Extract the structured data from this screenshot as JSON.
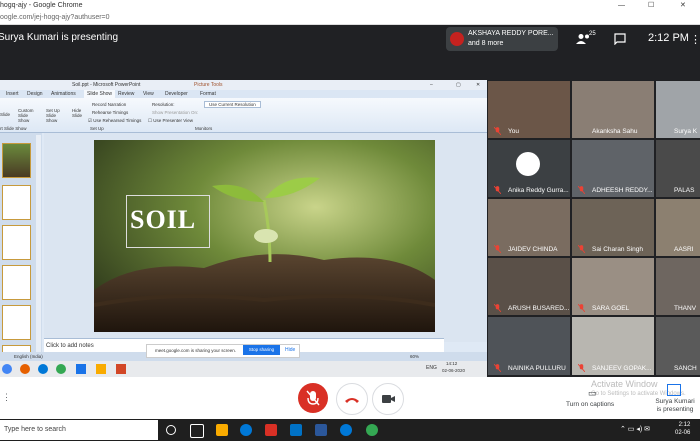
{
  "browser": {
    "tab_title": "hogq-ajy - Google Chrome",
    "url": "oogle.com/jej-hogq-ajy?authuser=0"
  },
  "meet": {
    "presenting_banner": "Surya Kumari is presenting",
    "notification_name": "AKSHAYA REDDY PORE...",
    "notification_more": "and 8 more",
    "people_count": "25",
    "time": "2:12 PM",
    "turn_on_captions": "Turn on captions",
    "presenter_line1": "Surya Kumari",
    "presenter_line2": "is presenting",
    "watermark_title": "Activate Window",
    "watermark_sub": "Go to Settings to activate Windows."
  },
  "powerpoint": {
    "window_title": "Soil.ppt - Microsoft PowerPoint",
    "picture_tools": "Picture Tools",
    "tabs": [
      "Insert",
      "Design",
      "Animations",
      "Slide Show",
      "Review",
      "View",
      "Developer",
      "Format"
    ],
    "ribbon": {
      "record_narration": "Record Narration",
      "rehearse_timings": "Rehearse Timings",
      "use_rehearsed": "Use Rehearsed Timings",
      "resolution": "Resolution:",
      "use_current_resolution": "Use Current Resolution",
      "show_presentation_on": "Show Presentation On:",
      "use_presenter_view": "Use Presenter View",
      "custom_slide_show": "Custom Slide Show",
      "set_up_slide_show": "Set Up Slide Show",
      "hide_slide": "Hide Slide",
      "slide_label": "Slide",
      "group_start": "rt Slide Show",
      "group_setup": "Set Up",
      "group_monitors": "Monitors"
    },
    "slide_word": "SOIL",
    "notes_placeholder": "Click to add notes",
    "status_language": "English (India)",
    "zoom": "60%",
    "share_notice": "meet.google.com is sharing your screen.",
    "stop_sharing": "Stop sharing",
    "hide": "Hide",
    "inner_clock_time": "14:12",
    "inner_clock_date": "02-06-2020",
    "inner_lang": "ENG"
  },
  "participants": [
    {
      "name": "You"
    },
    {
      "name": "Akanksha Sahu"
    },
    {
      "name": "Surya K"
    },
    {
      "name": "Anika Reddy Gurra..."
    },
    {
      "name": "ADHEESH REDDY..."
    },
    {
      "name": "PALAS"
    },
    {
      "name": "JAIDEV CHINDA"
    },
    {
      "name": "Sai Charan Singh"
    },
    {
      "name": "AASRI"
    },
    {
      "name": "ARUSH BUSARED..."
    },
    {
      "name": "SARA GOEL"
    },
    {
      "name": "THANV"
    },
    {
      "name": "NAINIKA PULLURU"
    },
    {
      "name": "SANJEEV GOPAK..."
    },
    {
      "name": "SANCH"
    }
  ],
  "taskbar": {
    "search_placeholder": "Type here to search",
    "time": "2:12",
    "date": "02-06"
  },
  "colors": {
    "meet_dark": "#202124",
    "tile": "#3c4043",
    "mic_red": "#d93025",
    "accent_blue": "#1a73e8"
  }
}
